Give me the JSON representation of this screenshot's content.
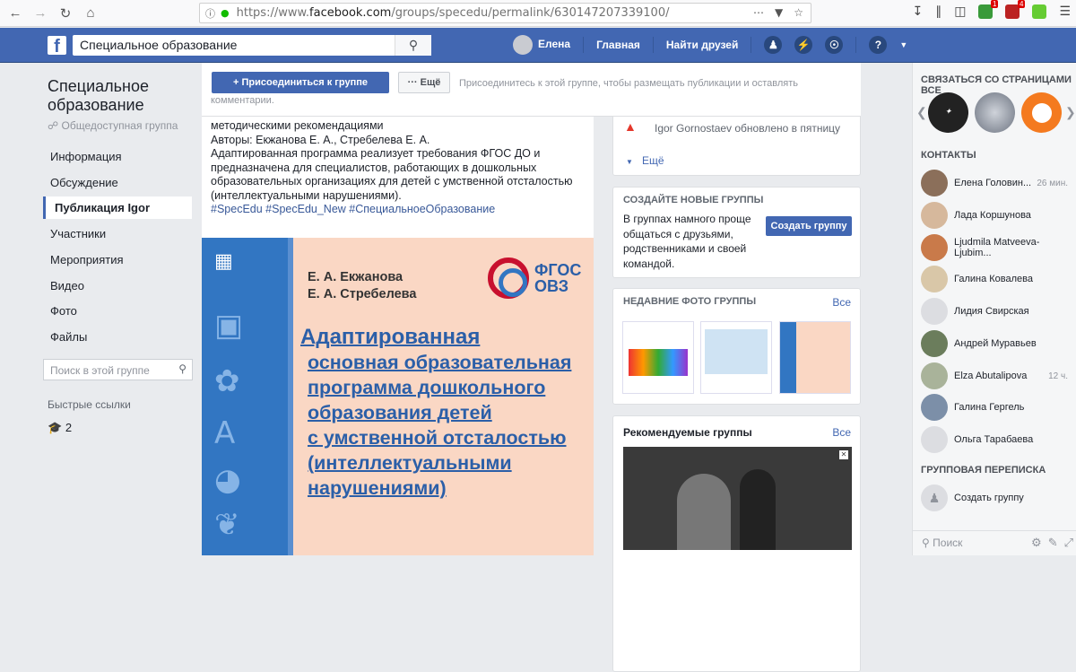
{
  "browser": {
    "url_prefix": "https://www.",
    "url_domain": "facebook.com",
    "url_path": "/groups/specedu/permalink/630147207339100/",
    "ext_badge_1": "1",
    "ext_badge_2": "4"
  },
  "fb": {
    "search_value": "Специальное образование",
    "user_name": "Елена",
    "nav_home": "Главная",
    "nav_find_friends": "Найти друзей"
  },
  "group": {
    "title": "Специальное образование",
    "type": "Общедоступная группа",
    "nav": [
      {
        "label": "Информация"
      },
      {
        "label": "Обсуждение"
      },
      {
        "label": "Публикация Igor"
      },
      {
        "label": "Участники"
      },
      {
        "label": "Мероприятия"
      },
      {
        "label": "Видео"
      },
      {
        "label": "Фото"
      },
      {
        "label": "Файлы"
      }
    ],
    "search_placeholder": "Поиск в этой группе",
    "quick_links_header": "Быстрые ссылки",
    "quick_link_count": "2"
  },
  "join": {
    "join_label": "+ Присоединиться к группе",
    "more_label": "··· Ещё",
    "hint": "Присоединитесь к этой группе, чтобы размещать публикации и оставлять комментарии."
  },
  "post": {
    "line1": "методическими рекомендациями",
    "line2": "Авторы: Екжанова Е. А., Стребелева Е. А.",
    "line3": "Адаптированная программа реализует требования ФГОС ДО и предназначена для специалистов, работающих в дошкольных образовательных организациях для детей с умственной отсталостью (интеллектуальными нарушениями).",
    "tags": "#SpecEdu #SpecEdu_New #СпециальноеОбразование",
    "image": {
      "author1": "Е. А. Екжанова",
      "author2": "Е. А. Стребелева",
      "fgos1": "ФГОС",
      "fgos2": "ОВЗ",
      "title_first": "Адаптированная",
      "title_lines": [
        "основная образовательная",
        "программа дошкольного",
        "образования детей",
        "с умственной отсталостью",
        "(интеллектуальными",
        "нарушениями)"
      ]
    }
  },
  "sidebar_mid": {
    "file_update": "Igor Gornostaev обновлено в пятницу",
    "more": "Ещё",
    "create_header": "СОЗДАЙТЕ НОВЫЕ ГРУППЫ",
    "create_desc": "В группах намного проще общаться с друзьями, родственниками и своей командой.",
    "create_btn": "Создать группу",
    "photos_header": "НЕДАВНИЕ ФОТО ГРУППЫ",
    "photos_all": "Все",
    "rec_header": "Рекомендуемые группы",
    "rec_all": "Все"
  },
  "chat": {
    "pages_header": "СВЯЗАТЬСЯ СО СТРАНИЦАМИ ВСЕ",
    "contacts_header": "КОНТАКТЫ",
    "contacts": [
      {
        "name": "Елена Головин...",
        "time": "26 мин."
      },
      {
        "name": "Лада Коршунова",
        "time": ""
      },
      {
        "name": "Ljudmila Matveeva-Ljubim...",
        "time": ""
      },
      {
        "name": "Галина Ковалева",
        "time": ""
      },
      {
        "name": "Лидия Свирская",
        "time": ""
      },
      {
        "name": "Андрей Муравьев",
        "time": ""
      },
      {
        "name": "Elza Abutalipova",
        "time": "12 ч."
      },
      {
        "name": "Галина Гергель",
        "time": ""
      },
      {
        "name": "Ольга Тарабаева",
        "time": ""
      }
    ],
    "group_chat_header": "ГРУППОВАЯ ПЕРЕПИСКА",
    "create_group": "Создать группу",
    "search_placeholder": "Поиск"
  },
  "colors": {
    "fb_blue": "#4267b2",
    "link": "#385898"
  }
}
